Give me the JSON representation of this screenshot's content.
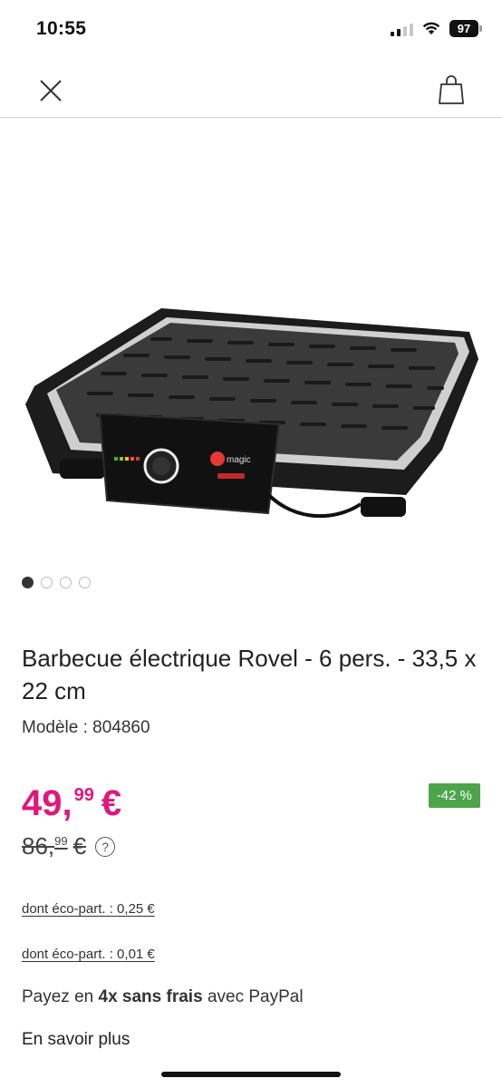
{
  "status_bar": {
    "time": "10:55",
    "battery": "97"
  },
  "product": {
    "title": "Barbecue électrique Rovel - 6 pers. - 33,5 x 22 cm",
    "model_label": "Modèle :",
    "model_value": "804860",
    "brand_on_image": "magic",
    "gallery": {
      "image_count": 4,
      "active_index": 0
    }
  },
  "price": {
    "integer": "49,",
    "decimals": "99",
    "currency": "€",
    "old_integer": "86,",
    "old_decimals": "99",
    "old_currency": "€",
    "discount": "-42 %",
    "help_glyph": "?"
  },
  "eco_participation": [
    "dont éco-part. : 0,25 €",
    "dont éco-part. : 0,01 €"
  ],
  "paypal": {
    "prefix": "Payez en",
    "highlight": "4x sans frais",
    "suffix": "avec PayPal"
  },
  "learn_more": "En savoir plus",
  "colors": {
    "price": "#e0187b",
    "discount_bg": "#4ca54a"
  },
  "icons": {
    "close": "close-icon",
    "cart": "shopping-bag-icon"
  }
}
